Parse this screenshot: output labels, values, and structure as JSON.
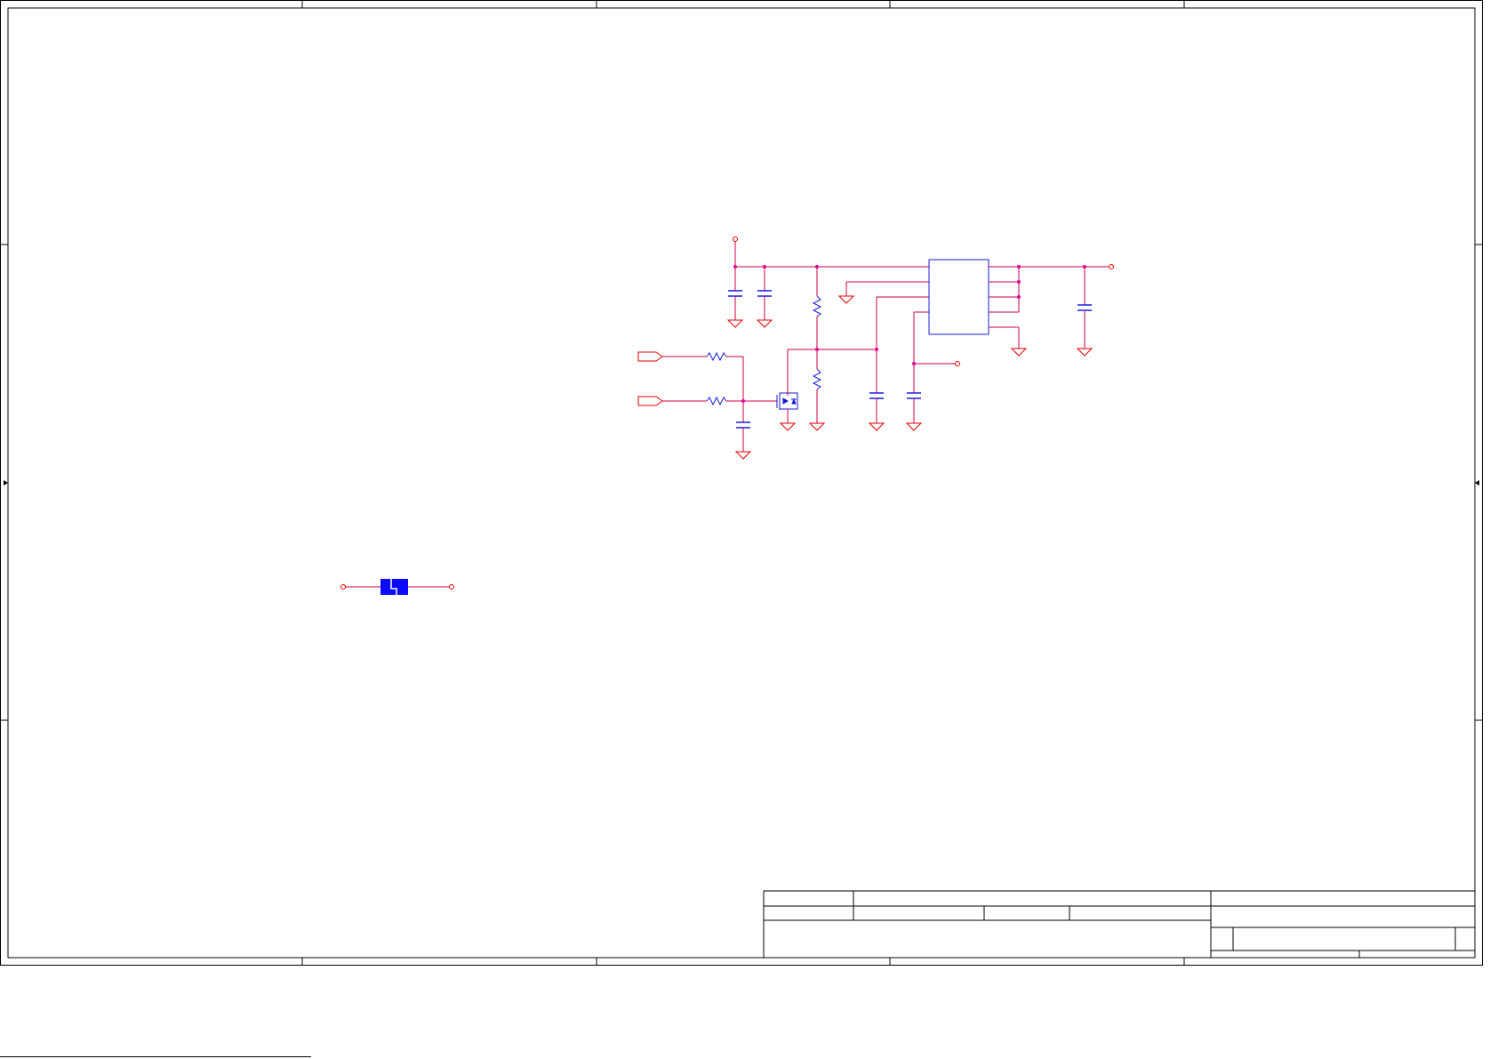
{
  "sheet": {
    "footer_text": "",
    "title_block": {}
  },
  "colors": {
    "background": "#ffffff",
    "border": "#000000",
    "wire": "#cc0044",
    "power_symbol": "#e60000",
    "component": "#1a1ad6",
    "junction": "#e0009c",
    "port": "#e60000",
    "blue_fill": "#0a0aff"
  },
  "components": [
    {
      "kind": "connector-dot",
      "name": "power-port-top"
    },
    {
      "kind": "capacitor",
      "name": "capacitor-c1"
    },
    {
      "kind": "capacitor",
      "name": "capacitor-c2"
    },
    {
      "kind": "resistor",
      "name": "resistor-r-upper"
    },
    {
      "kind": "resistor",
      "name": "resistor-r-lower"
    },
    {
      "kind": "ic",
      "name": "regulator-ic"
    },
    {
      "kind": "capacitor",
      "name": "capacitor-output"
    },
    {
      "kind": "connector-dot",
      "name": "output-port"
    },
    {
      "kind": "offpage-port",
      "name": "input-port-a"
    },
    {
      "kind": "offpage-port",
      "name": "input-port-b"
    },
    {
      "kind": "resistor",
      "name": "resistor-input-a"
    },
    {
      "kind": "resistor",
      "name": "resistor-input-b"
    },
    {
      "kind": "capacitor",
      "name": "capacitor-input-filter"
    },
    {
      "kind": "mosfet",
      "name": "mosfet-q1"
    },
    {
      "kind": "capacitor",
      "name": "capacitor-c-mid1"
    },
    {
      "kind": "capacitor",
      "name": "capacitor-c-mid2"
    },
    {
      "kind": "connector-dot",
      "name": "signal-port-right"
    },
    {
      "kind": "ferrite-bead",
      "name": "ferrite-bead"
    },
    {
      "kind": "ground",
      "name": "ground-symbol"
    }
  ]
}
